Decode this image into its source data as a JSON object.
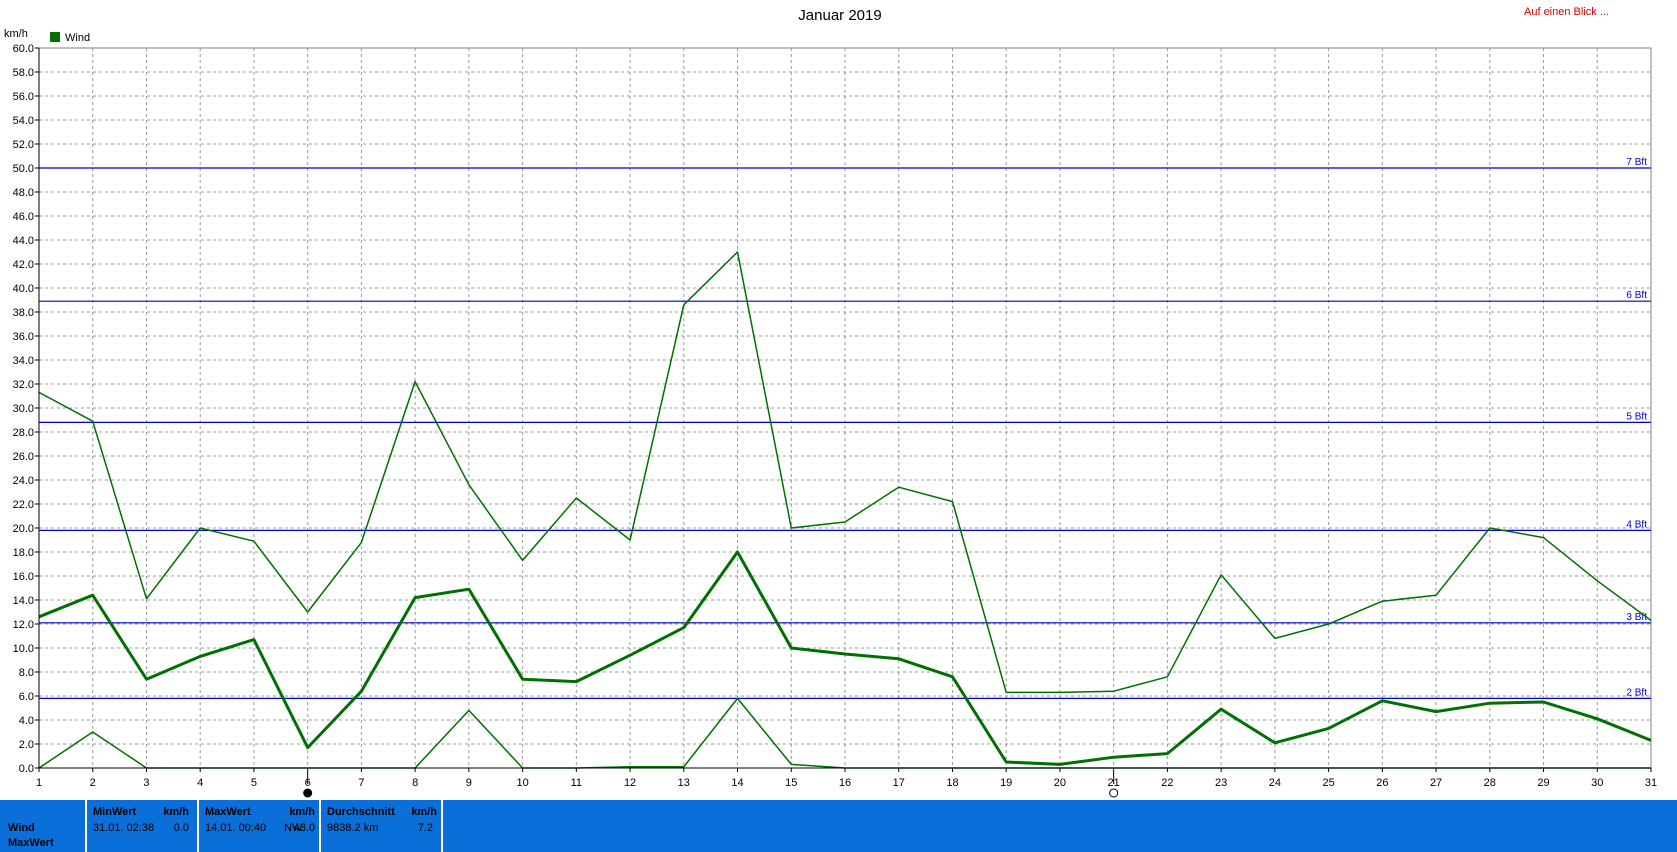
{
  "title": "Januar 2019",
  "quick_link": "Auf einen Blick ...",
  "unit": "km/h",
  "colors": {
    "series": "#007000",
    "beaufort": "#0000cc",
    "grid": "#999999",
    "panel": "#0a6fd8",
    "link": "#e00000"
  },
  "chart_data": {
    "type": "line",
    "title": "Januar 2019",
    "ylabel": "km/h",
    "ylim": [
      0,
      60
    ],
    "grid": true,
    "legend": "top-left",
    "x": [
      1,
      2,
      3,
      4,
      5,
      6,
      7,
      8,
      9,
      10,
      11,
      12,
      13,
      14,
      15,
      16,
      17,
      18,
      19,
      20,
      21,
      22,
      23,
      24,
      25,
      26,
      27,
      28,
      29,
      30,
      31
    ],
    "x_tick_labels": [
      "1",
      "2",
      "3",
      "4",
      "5",
      "6",
      "7",
      "8",
      "9",
      "10",
      "11",
      "12",
      "13",
      "14",
      "15",
      "16",
      "17",
      "18",
      "19",
      "20",
      "21",
      "22",
      "23",
      "24",
      "25",
      "26",
      "27",
      "28",
      "29",
      "30",
      "31"
    ],
    "y_tick_labels": [
      "0.0",
      "2.0",
      "4.0",
      "6.0",
      "8.0",
      "10.0",
      "12.0",
      "14.0",
      "16.0",
      "18.0",
      "20.0",
      "22.0",
      "24.0",
      "26.0",
      "28.0",
      "30.0",
      "32.0",
      "34.0",
      "36.0",
      "38.0",
      "40.0",
      "42.0",
      "44.0",
      "46.0",
      "48.0",
      "50.0",
      "52.0",
      "54.0",
      "56.0",
      "58.0",
      "60.0"
    ],
    "series": [
      {
        "name": "Wind",
        "legend": true,
        "width": 1.5,
        "values": [
          31.3,
          28.9,
          14.1,
          20.0,
          18.9,
          13.0,
          18.8,
          32.2,
          23.6,
          17.3,
          22.5,
          19.0,
          38.6,
          43.0,
          20.0,
          20.5,
          23.4,
          22.2,
          6.3,
          6.3,
          6.4,
          7.6,
          16.1,
          10.8,
          12.0,
          13.9,
          14.4,
          20.0,
          19.2,
          15.6,
          12.3
        ]
      },
      {
        "name": "",
        "legend": false,
        "width": 3,
        "values": [
          12.6,
          14.4,
          7.4,
          9.3,
          10.7,
          1.7,
          6.4,
          14.2,
          14.9,
          7.4,
          7.2,
          9.4,
          11.7,
          18.0,
          10.0,
          9.5,
          9.1,
          7.6,
          0.5,
          0.3,
          0.9,
          1.2,
          4.9,
          2.1,
          3.3,
          5.6,
          4.7,
          5.4,
          5.5,
          4.1,
          2.3
        ]
      },
      {
        "name": "",
        "legend": false,
        "width": 1.5,
        "values": [
          0.0,
          3.0,
          0.0,
          0.0,
          0.0,
          0.0,
          0.0,
          0.0,
          4.8,
          0.0,
          0.0,
          0.1,
          0.1,
          5.8,
          0.3,
          0.0,
          0.0,
          0.0,
          0.0,
          0.0,
          0.0,
          0.0,
          0.0,
          0.0,
          0.0,
          0.0,
          0.0,
          0.0,
          0.0,
          0.0,
          0.0
        ]
      }
    ],
    "reference_lines": [
      {
        "label": "2 Bft",
        "value": 5.8
      },
      {
        "label": "3 Bft",
        "value": 12.1
      },
      {
        "label": "4 Bft",
        "value": 19.8
      },
      {
        "label": "5 Bft",
        "value": 28.8
      },
      {
        "label": "6 Bft",
        "value": 38.9
      },
      {
        "label": "7 Bft",
        "value": 50.0
      }
    ],
    "markers": [
      {
        "day": 6,
        "symbol": "new-moon"
      },
      {
        "day": 21,
        "symbol": "full-moon"
      }
    ]
  },
  "panel": {
    "row1": "Wind",
    "row2": "MaxWert",
    "min_header": "MinWert",
    "min_unit": "km/h",
    "min_time": "31.01.  02:38",
    "min_value": "0.0",
    "max_header": "MaxWert",
    "max_unit": "km/h",
    "max_time": "14.01.  00:40",
    "max_dir": "NW",
    "max_value": "43.0",
    "avg_header": "Durchschnitt",
    "avg_unit": "km/h",
    "avg_distance": "9838.2 km",
    "avg_value": "7.2"
  }
}
